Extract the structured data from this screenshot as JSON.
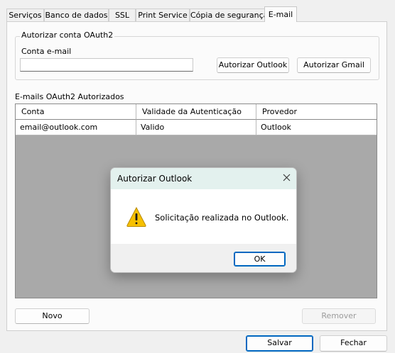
{
  "tabs": [
    {
      "label": "Serviços"
    },
    {
      "label": "Banco de dados"
    },
    {
      "label": "SSL"
    },
    {
      "label": "Print Service"
    },
    {
      "label": "Cópia de segurança"
    },
    {
      "label": "E-mail",
      "active": true
    }
  ],
  "oauth_group": {
    "title": "Autorizar conta OAuth2",
    "email_label": "Conta e-mail",
    "email_value": "",
    "authorize_outlook_label": "Autorizar Outlook",
    "authorize_gmail_label": "Autorizar Gmail"
  },
  "authorized_list": {
    "title": "E-mails OAuth2 Autorizados",
    "columns": [
      "Conta",
      "Validade da Autenticação",
      "Provedor"
    ],
    "rows": [
      [
        "email@outlook.com",
        "Valido",
        "Outlook"
      ]
    ]
  },
  "panel_buttons": {
    "new_label": "Novo",
    "remove_label": "Remover"
  },
  "footer_buttons": {
    "save_label": "Salvar",
    "close_label": "Fechar"
  },
  "dialog": {
    "title": "Autorizar Outlook",
    "message": "Solicitação realizada no Outlook.",
    "ok_label": "OK",
    "icon": "warning-icon",
    "close_icon": "close-icon"
  },
  "colors": {
    "dialog_title_bg": "#e3f1ee",
    "grid_empty_bg": "#a9a9a9",
    "primary_border": "#0067c0",
    "warning_yellow": "#f6c000"
  }
}
